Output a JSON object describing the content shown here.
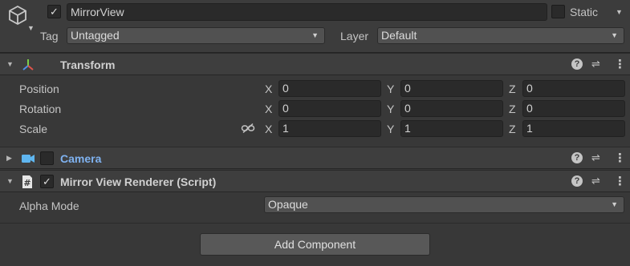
{
  "header": {
    "object_active": true,
    "name": "MirrorView",
    "static_label": "Static",
    "static_checked": false,
    "tag_label": "Tag",
    "tag_value": "Untagged",
    "layer_label": "Layer",
    "layer_value": "Default"
  },
  "transform": {
    "title": "Transform",
    "rows": [
      {
        "label": "Position",
        "x": "0",
        "y": "0",
        "z": "0"
      },
      {
        "label": "Rotation",
        "x": "0",
        "y": "0",
        "z": "0"
      },
      {
        "label": "Scale",
        "x": "1",
        "y": "1",
        "z": "1"
      }
    ],
    "axis": {
      "x": "X",
      "y": "Y",
      "z": "Z"
    }
  },
  "camera": {
    "title": "Camera",
    "enabled": false
  },
  "mirror": {
    "title": "Mirror View Renderer (Script)",
    "enabled": true,
    "alpha_mode_label": "Alpha Mode",
    "alpha_mode_value": "Opaque"
  },
  "add_component_label": "Add Component",
  "colors": {
    "background": "#383838",
    "camera_title": "#7fb2f0",
    "field": "#2a2a2a"
  }
}
